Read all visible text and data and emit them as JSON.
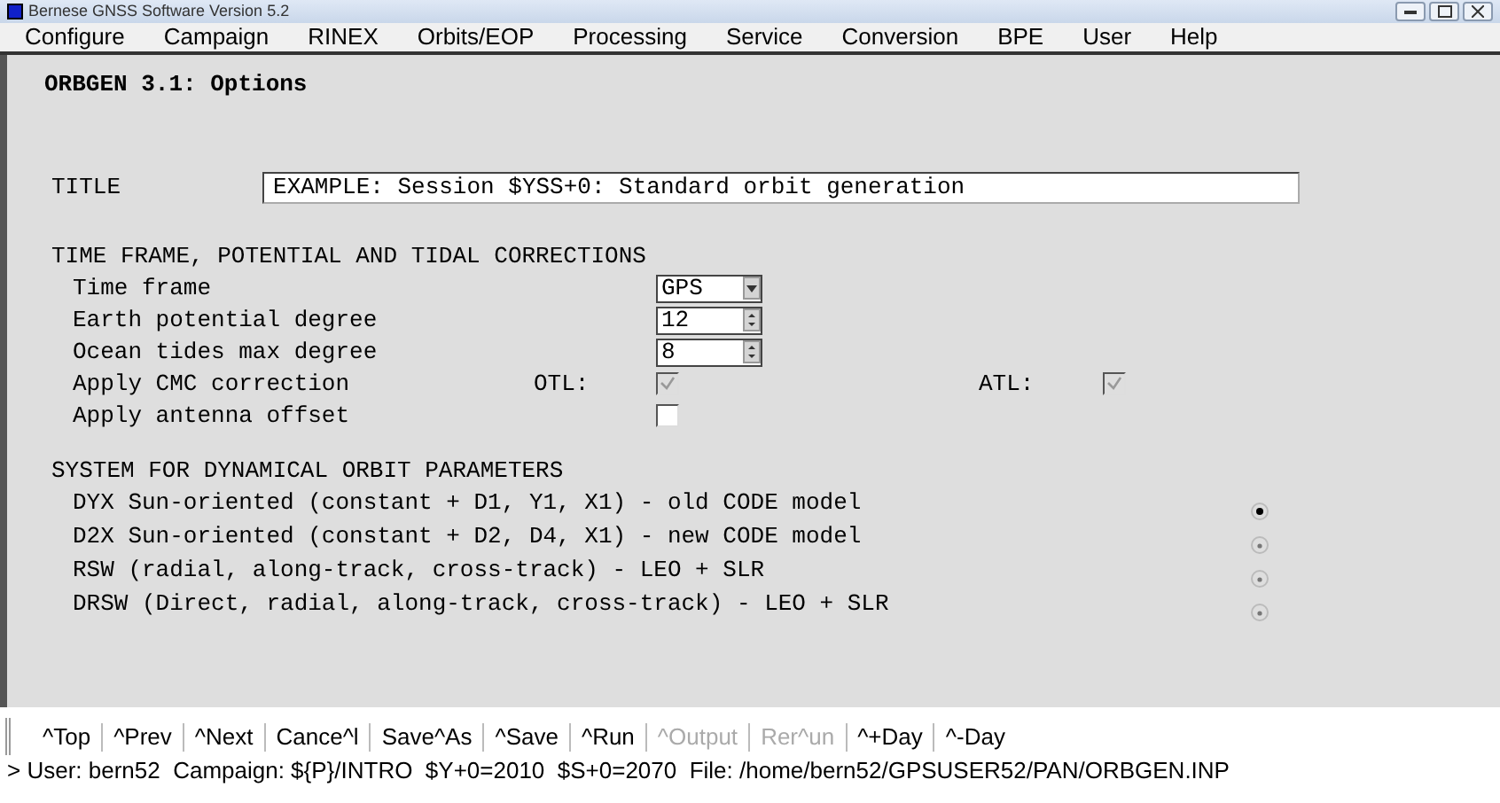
{
  "window": {
    "title": "Bernese GNSS Software Version 5.2"
  },
  "menu": [
    "Configure",
    "Campaign",
    "RINEX",
    "Orbits/EOP",
    "Processing",
    "Service",
    "Conversion",
    "BPE",
    "User",
    "Help"
  ],
  "panel_title": "ORBGEN 3.1: Options",
  "title_field": {
    "label": "TITLE",
    "value": "EXAMPLE: Session $YSS+0: Standard orbit generation"
  },
  "section1": {
    "heading": "TIME FRAME, POTENTIAL AND TIDAL CORRECTIONS",
    "options": [
      {
        "kind": "select",
        "label": "Time frame",
        "value": "GPS"
      },
      {
        "kind": "spinner",
        "label": "Earth potential degree",
        "value": "12"
      },
      {
        "kind": "spinner",
        "label": "Ocean tides max degree",
        "value": "8"
      },
      {
        "kind": "pair",
        "label": "Apply CMC correction",
        "checks": [
          {
            "label": "OTL:",
            "checked": true,
            "disabled": true
          },
          {
            "label": "ATL:",
            "checked": true,
            "disabled": true
          }
        ]
      },
      {
        "kind": "checkbox",
        "label": "Apply antenna offset",
        "checked": false,
        "disabled": false
      }
    ]
  },
  "section2": {
    "heading": "SYSTEM FOR DYNAMICAL ORBIT PARAMETERS",
    "options": [
      {
        "label": "DYX Sun-oriented (constant + D1, Y1, X1) - old CODE model",
        "selected": true
      },
      {
        "label": "D2X Sun-oriented (constant + D2, D4, X1) - new CODE model",
        "selected": false
      },
      {
        "label": "RSW (radial, along-track, cross-track) - LEO + SLR",
        "selected": false
      },
      {
        "label": "DRSW (Direct, radial, along-track, cross-track) - LEO + SLR",
        "selected": false
      }
    ]
  },
  "toolbar": [
    {
      "label": "^Top",
      "disabled": false
    },
    {
      "label": "^Prev",
      "disabled": false
    },
    {
      "label": "^Next",
      "disabled": false
    },
    {
      "label": "Cance^l",
      "disabled": false
    },
    {
      "label": "Save^As",
      "disabled": false
    },
    {
      "label": "^Save",
      "disabled": false
    },
    {
      "label": "^Run",
      "disabled": false
    },
    {
      "label": "^Output",
      "disabled": true
    },
    {
      "label": "Rer^un",
      "disabled": true
    },
    {
      "label": "^+Day",
      "disabled": false
    },
    {
      "label": "^-Day",
      "disabled": false
    }
  ],
  "status_bar": "> User: bern52  Campaign: ${P}/INTRO  $Y+0=2010  $S+0=2070  File: /home/bern52/GPSUSER52/PAN/ORBGEN.INP"
}
